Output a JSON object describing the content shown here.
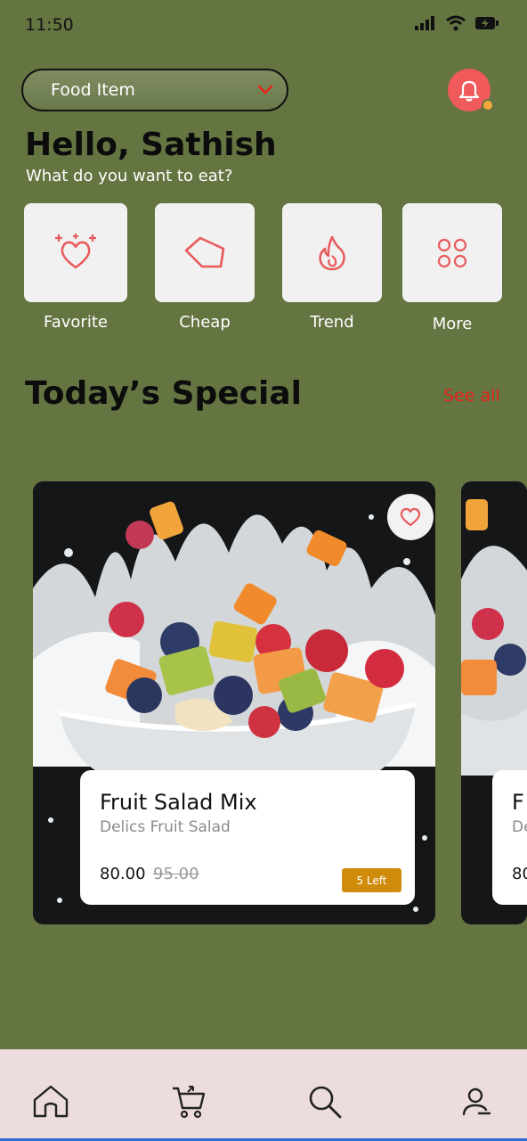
{
  "status_bar": {
    "time": "11:50"
  },
  "header": {
    "dropdown_label": "Food Item",
    "greeting": "Hello, Sathish",
    "subtitle": "What do you want to eat?"
  },
  "categories": [
    {
      "label": "Favorite",
      "icon": "heart-sparkle-icon"
    },
    {
      "label": "Cheap",
      "icon": "price-tag-icon"
    },
    {
      "label": "Trend",
      "icon": "flame-icon"
    },
    {
      "label": "More",
      "icon": "grid-circles-icon"
    }
  ],
  "special": {
    "title": "Today’s Special",
    "see_all": "See all"
  },
  "cards": [
    {
      "title": "Fruit Salad Mix",
      "subtitle": "Delics Fruit Salad",
      "price": "80.00",
      "old_price": "95.00",
      "badge": "5 Left"
    },
    {
      "title": "F",
      "subtitle": "De",
      "price": "80"
    }
  ],
  "bottom_nav": [
    {
      "icon": "home-icon"
    },
    {
      "icon": "cart-icon"
    },
    {
      "icon": "search-icon"
    },
    {
      "icon": "profile-icon"
    }
  ],
  "colors": {
    "background": "#647542",
    "accent": "#f05a5a",
    "see_all": "#e8231c",
    "badge": "#d08b0a",
    "nav_bg": "#ecdcdc"
  }
}
